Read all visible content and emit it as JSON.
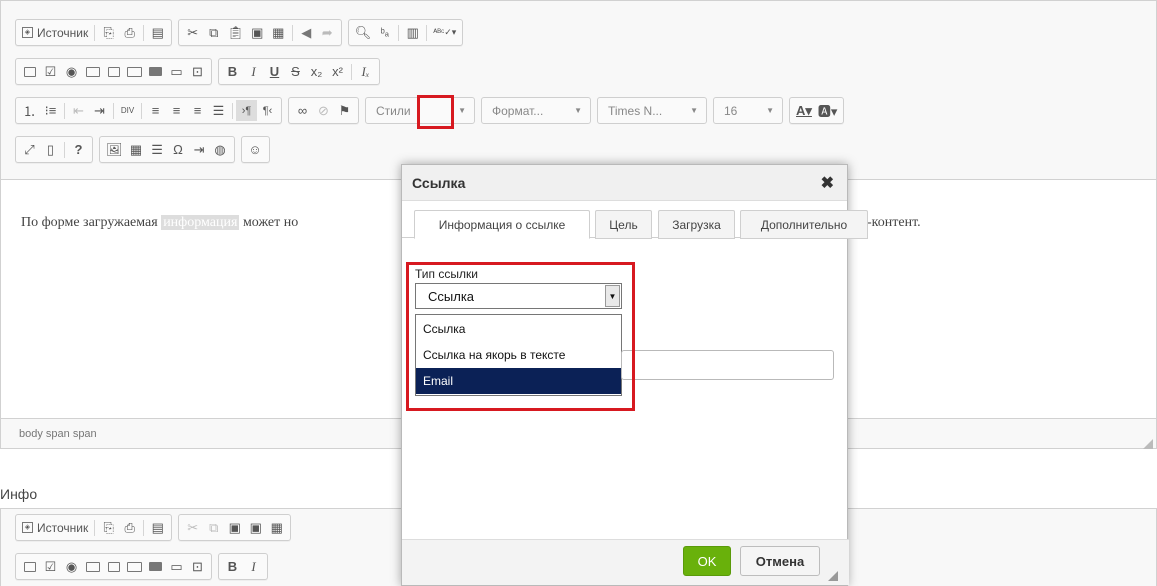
{
  "toolbar": {
    "source_label": "Источник",
    "styles_label": "Стили",
    "format_label": "Формат...",
    "font_label": "Times N...",
    "size_label": "16"
  },
  "content": {
    "text_before": "По форме загружаемая ",
    "text_selected": "информация",
    "text_after": " может но",
    "text_tail": "-контент."
  },
  "statusbar": {
    "path": "body  span  span"
  },
  "second_editor": {
    "label": "Инфо",
    "source_label": "Источник"
  },
  "dialog": {
    "title": "Ссылка",
    "tabs": [
      "Информация о ссылке",
      "Цель",
      "Загрузка",
      "Дополнительно"
    ],
    "active_tab": 0,
    "link_type_label": "Тип ссылки",
    "link_type_value": "Ссылка",
    "options": [
      "Ссылка",
      "Ссылка на якорь в тексте",
      "Email"
    ],
    "highlighted_option": 2,
    "ok_label": "OK",
    "cancel_label": "Отмена"
  },
  "colors": {
    "highlight_border": "#d71920",
    "ok_button": "#69b10b",
    "selected_option": "#0b2156"
  }
}
